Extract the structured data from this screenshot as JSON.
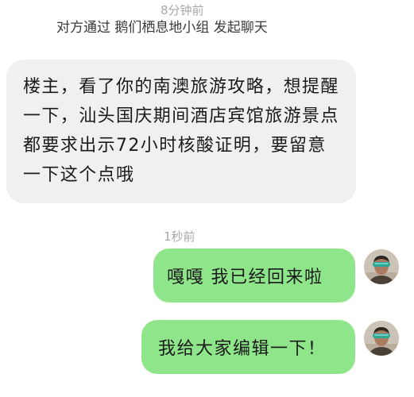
{
  "chat": {
    "time_top": "8分钟前",
    "system_message": "对方通过 鹅们栖息地小组 发起聊天",
    "incoming_message": "楼主，看了你的南澳旅游攻略，想提醒一下，汕头国庆期间酒店宾馆旅游景点都要求出示72小时核酸证明，要留意一下这个点哦",
    "time_mid": "1秒前",
    "outgoing_messages": [
      {
        "text": "嘎嘎 我已经回来啦"
      },
      {
        "text": "我给大家编辑一下！"
      }
    ]
  },
  "icons": {
    "avatar": "user-avatar-icon"
  },
  "colors": {
    "incoming_bubble": "#f0f0f0",
    "outgoing_bubble": "#8fe58a",
    "timestamp": "#a8a8a8"
  }
}
